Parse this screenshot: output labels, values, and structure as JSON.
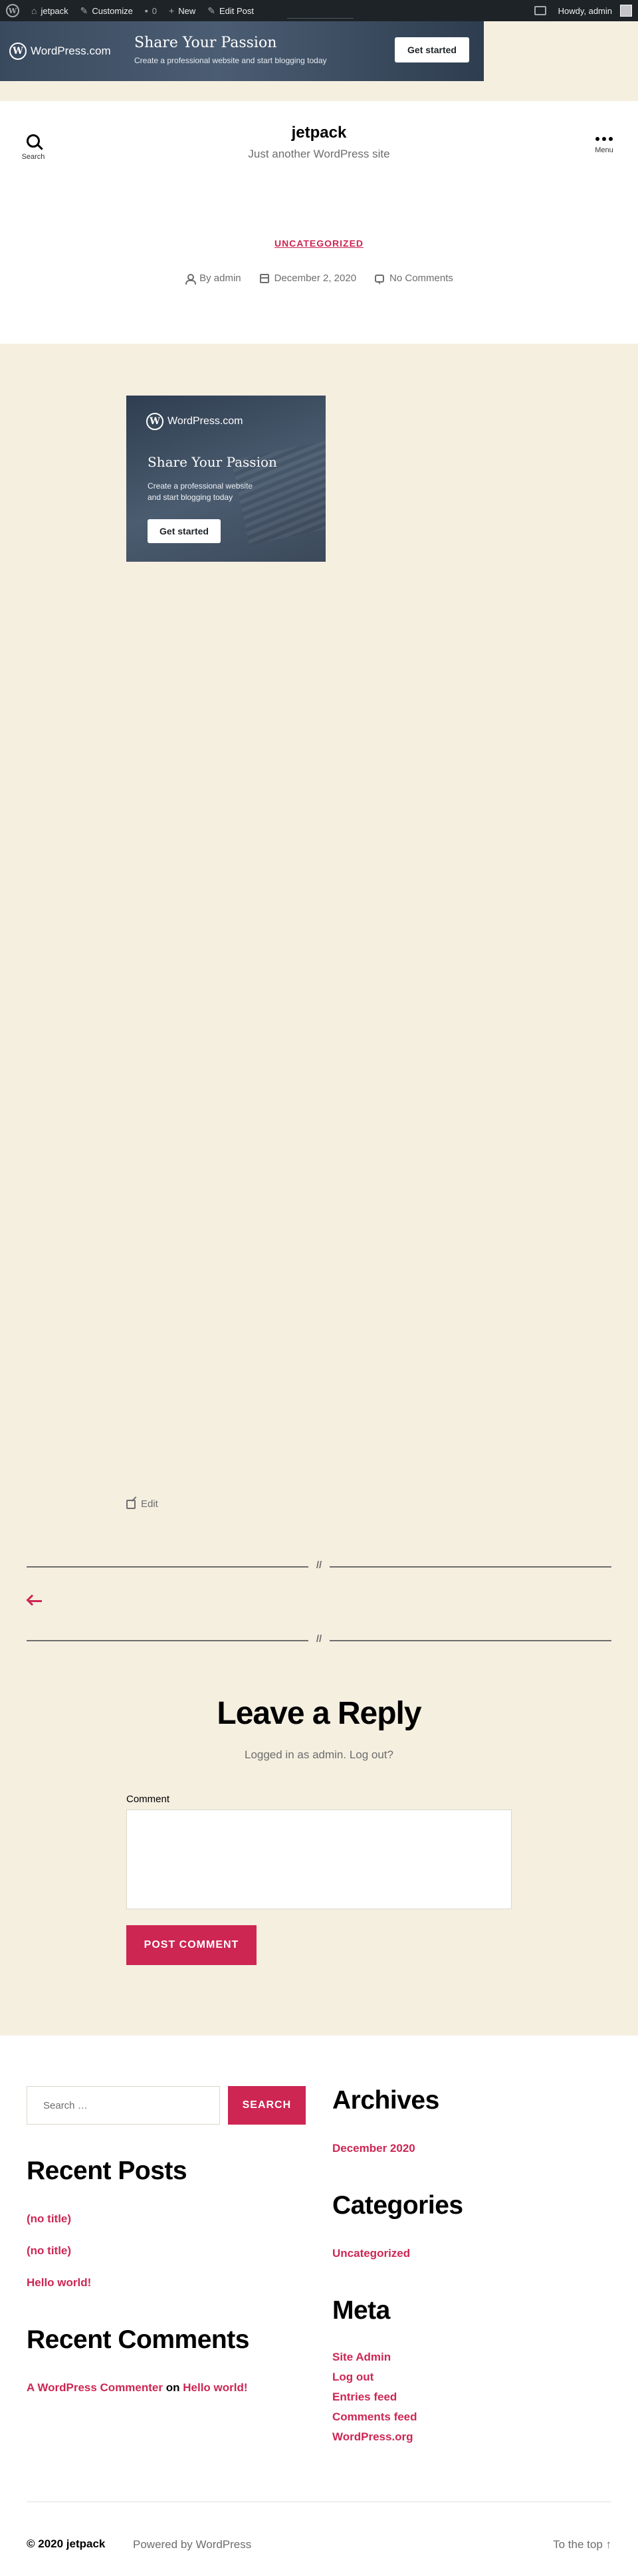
{
  "adminbar": {
    "wp_logo": "W",
    "site_name": "jetpack",
    "customize": "Customize",
    "comments_count": "0",
    "new": "New",
    "edit_post": "Edit Post",
    "howdy": "Howdy, admin"
  },
  "top_banner": {
    "logo_text": "WordPress.com",
    "headline": "Share Your Passion",
    "subtext": "Create a professional website and start blogging today",
    "cta": "Get started"
  },
  "header": {
    "search_label": "Search",
    "site_title": "jetpack",
    "site_description": "Just another WordPress site",
    "menu_label": "Menu"
  },
  "post": {
    "category": "UNCATEGORIZED",
    "author": "By admin",
    "date": "December 2, 2020",
    "comments": "No Comments",
    "edit": "Edit"
  },
  "content_ad": {
    "logo_text": "WordPress.com",
    "headline": "Share Your Passion",
    "subtext": "Create a professional website and start blogging today",
    "cta": "Get started"
  },
  "separators": {
    "mark": "//"
  },
  "reply": {
    "title": "Leave a Reply",
    "logged_in": "Logged in as admin. Log out?",
    "comment_label": "Comment",
    "submit": "POST COMMENT"
  },
  "footer": {
    "search_placeholder": "Search …",
    "search_button": "SEARCH",
    "recent_posts": {
      "title": "Recent Posts",
      "items": [
        "(no title)",
        "(no title)",
        "Hello world!"
      ]
    },
    "recent_comments": {
      "title": "Recent Comments",
      "author": "A WordPress Commenter",
      "on": "on",
      "post": "Hello world!"
    },
    "archives": {
      "title": "Archives",
      "items": [
        "December 2020"
      ]
    },
    "categories": {
      "title": "Categories",
      "items": [
        "Uncategorized"
      ]
    },
    "meta": {
      "title": "Meta",
      "items": [
        "Site Admin",
        "Log out",
        "Entries feed",
        "Comments feed",
        "WordPress.org"
      ]
    },
    "copyright": "© 2020 jetpack",
    "powered": "Powered by WordPress",
    "to_top": "To the top ↑"
  },
  "colors": {
    "accent": "#cd2653",
    "background": "#f5efe0",
    "adminbar": "#1d2327"
  }
}
